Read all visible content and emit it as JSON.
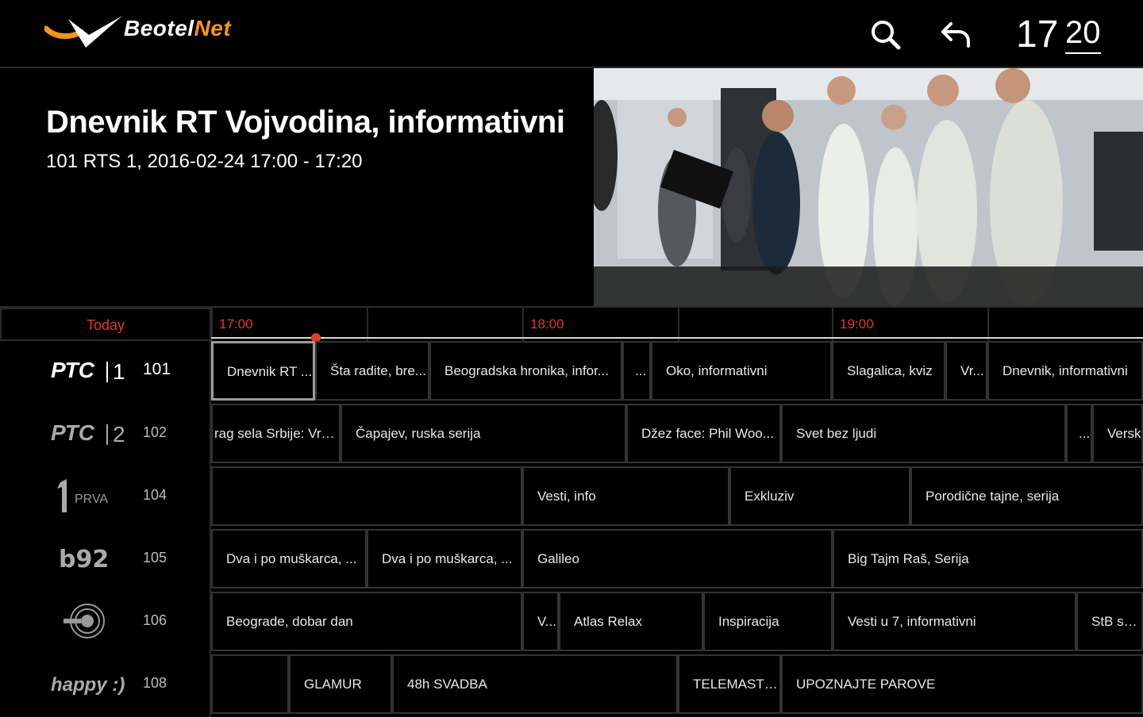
{
  "header": {
    "brand_part1": "Beotel",
    "brand_part2": "Net",
    "clock_hours": "17",
    "clock_minutes": "20"
  },
  "program": {
    "title": "Dnevnik RT Vojvodina, informativni",
    "subtitle": "101 RTS 1, 2016-02-24 17:00 - 17:20"
  },
  "timeline": {
    "today_label": "Today",
    "ticks": [
      "17:00",
      "18:00",
      "19:00"
    ]
  },
  "channels": [
    {
      "number": "101",
      "logo": "РТС|1"
    },
    {
      "number": "102",
      "logo": "РТС|2"
    },
    {
      "number": "104",
      "logo": "PRVA"
    },
    {
      "number": "105",
      "logo": "b92"
    },
    {
      "number": "106",
      "logo": "Studio B"
    },
    {
      "number": "108",
      "logo": "happy :)"
    }
  ],
  "rows": [
    [
      "Dnevnik RT ...",
      "Šta radite, bre...",
      "Beogradska hronika, infor...",
      "...",
      "Oko, informativni",
      "Slagalica, kviz",
      "Vr...",
      "Dnevnik, informativni"
    ],
    [
      "rag sela Srbije: Vra...",
      "Čapajev, ruska serija",
      "Džez face: Phil Woo...",
      "Svet bez ljudi",
      "...",
      "Versk"
    ],
    [
      "",
      "Vesti, info",
      "Exkluziv",
      "Porodične tajne, serija"
    ],
    [
      "Dva i po muškarca, ...",
      "Dva i po muškarca, ...",
      "Galileo",
      "Big Tajm Raš, Serija"
    ],
    [
      "Beograde, dobar dan",
      "V...",
      "Atlas Relax",
      "Inspiracija",
      "Vesti u 7, informativni",
      "StB spec"
    ],
    [
      "",
      "GLAMUR",
      "48h SVADBA",
      "TELEMASTER",
      "UPOZNAJTE PAROVE"
    ]
  ]
}
